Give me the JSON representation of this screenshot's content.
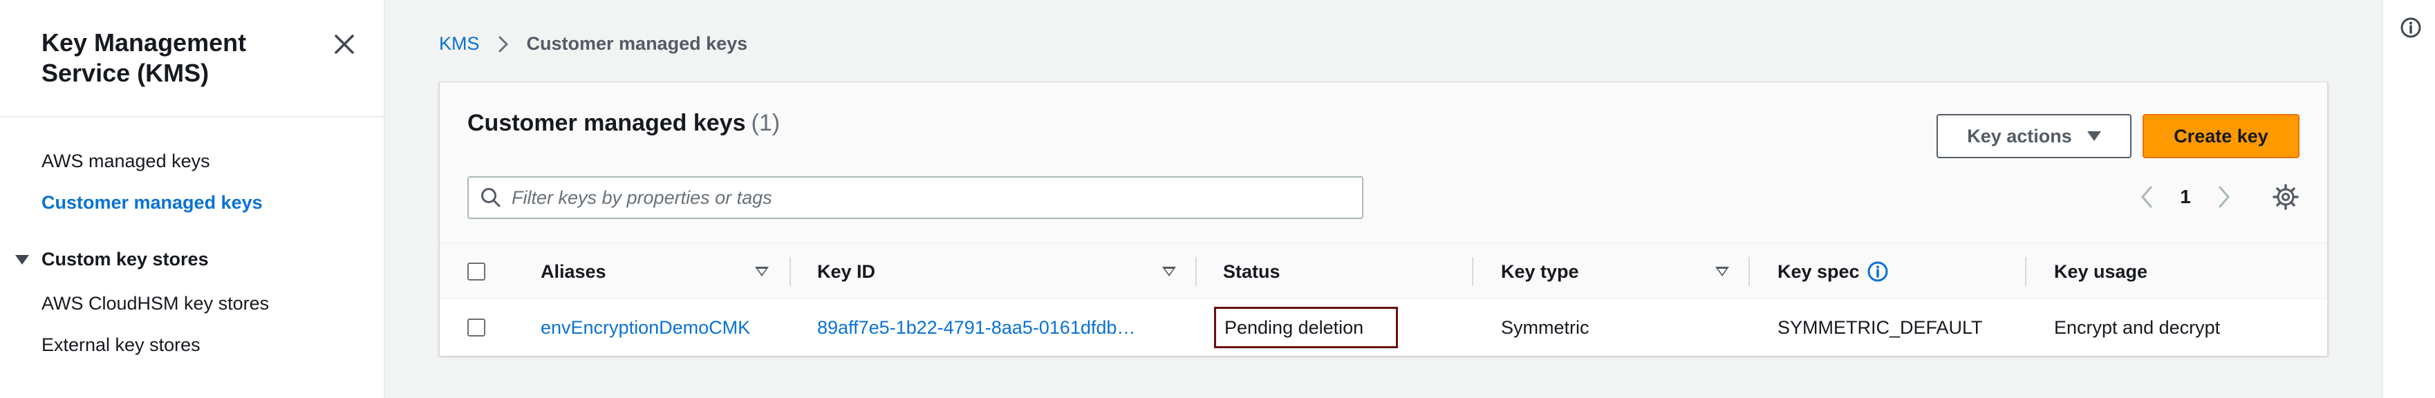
{
  "sidebar": {
    "title": "Key Management Service (KMS)",
    "items": [
      {
        "label": "AWS managed keys",
        "active": false
      },
      {
        "label": "Customer managed keys",
        "active": true
      }
    ],
    "section": {
      "label": "Custom key stores",
      "expanded": true
    },
    "section_items": [
      {
        "label": "AWS CloudHSM key stores"
      },
      {
        "label": "External key stores"
      }
    ]
  },
  "breadcrumb": {
    "root": "KMS",
    "current": "Customer managed keys"
  },
  "panel": {
    "title": "Customer managed keys",
    "count": "(1)",
    "key_actions_label": "Key actions",
    "create_key_label": "Create key",
    "search_placeholder": "Filter keys by properties or tags",
    "page_number": "1"
  },
  "table": {
    "columns": [
      "Aliases",
      "Key ID",
      "Status",
      "Key type",
      "Key spec",
      "Key usage"
    ],
    "rows": [
      {
        "alias": "envEncryptionDemoCMK",
        "key_id": "89aff7e5-1b22-4791-8aa5-0161dfdb…",
        "status": "Pending deletion",
        "key_type": "Symmetric",
        "key_spec": "SYMMETRIC_DEFAULT",
        "key_usage": "Encrypt and decrypt"
      }
    ]
  },
  "colors": {
    "link": "#0972d3",
    "primary_button": "#ff9900",
    "status_outline": "#6b0f0f",
    "text": "#16191f",
    "background": "#f2f3f3"
  },
  "icons": [
    "close-icon",
    "chevron-right-icon",
    "search-icon",
    "chevron-left-icon",
    "gear-icon",
    "info-icon",
    "caret-down-icon",
    "sort-icon"
  ]
}
